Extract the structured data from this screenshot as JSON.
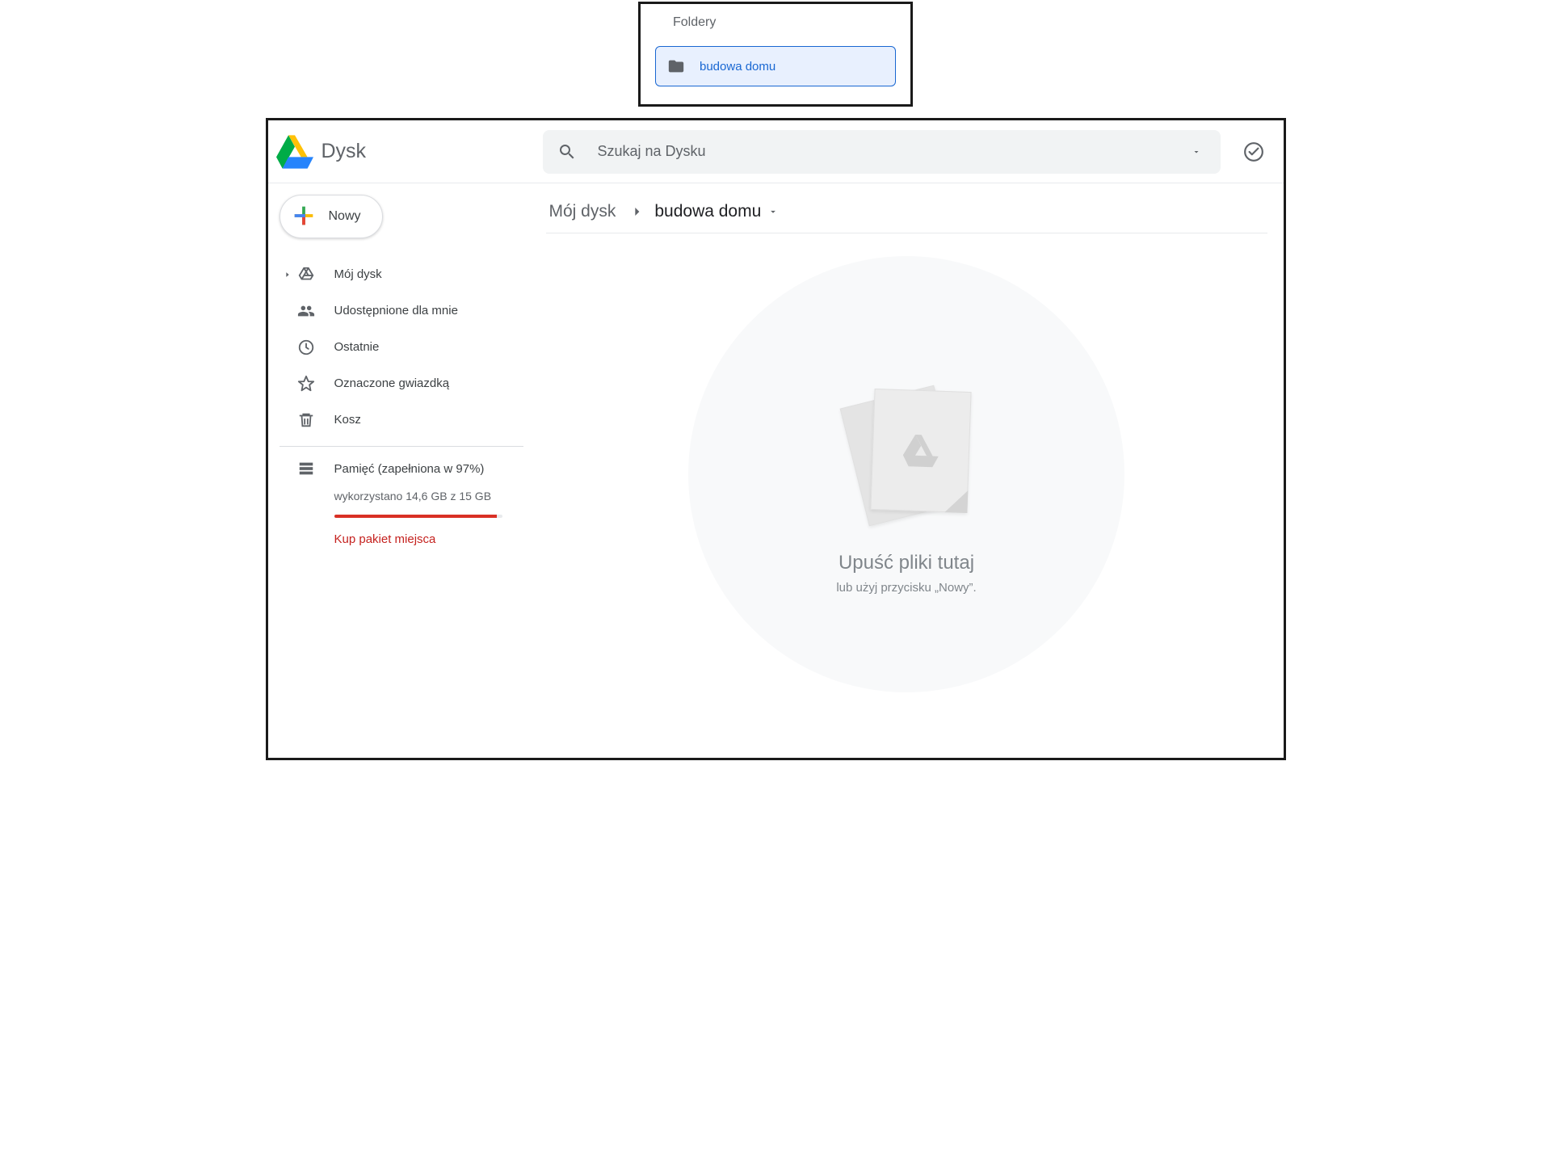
{
  "callout": {
    "section_label": "Foldery",
    "folder_name": "budowa domu"
  },
  "header": {
    "app_name": "Dysk",
    "search_placeholder": "Szukaj na Dysku"
  },
  "sidebar": {
    "new_button": "Nowy",
    "items": {
      "my_drive": "Mój dysk",
      "shared": "Udostępnione dla mnie",
      "recent": "Ostatnie",
      "starred": "Oznaczone gwiazdką",
      "trash": "Kosz"
    },
    "storage": {
      "title": "Pamięć (zapełniona w 97%)",
      "details": "wykorzystano 14,6 GB z 15 GB",
      "percent": 97,
      "buy_link": "Kup pakiet miejsca"
    }
  },
  "breadcrumb": {
    "root": "Mój dysk",
    "current": "budowa domu"
  },
  "empty_state": {
    "line1": "Upuść pliki tutaj",
    "line2": "lub użyj przycisku „Nowy”."
  }
}
